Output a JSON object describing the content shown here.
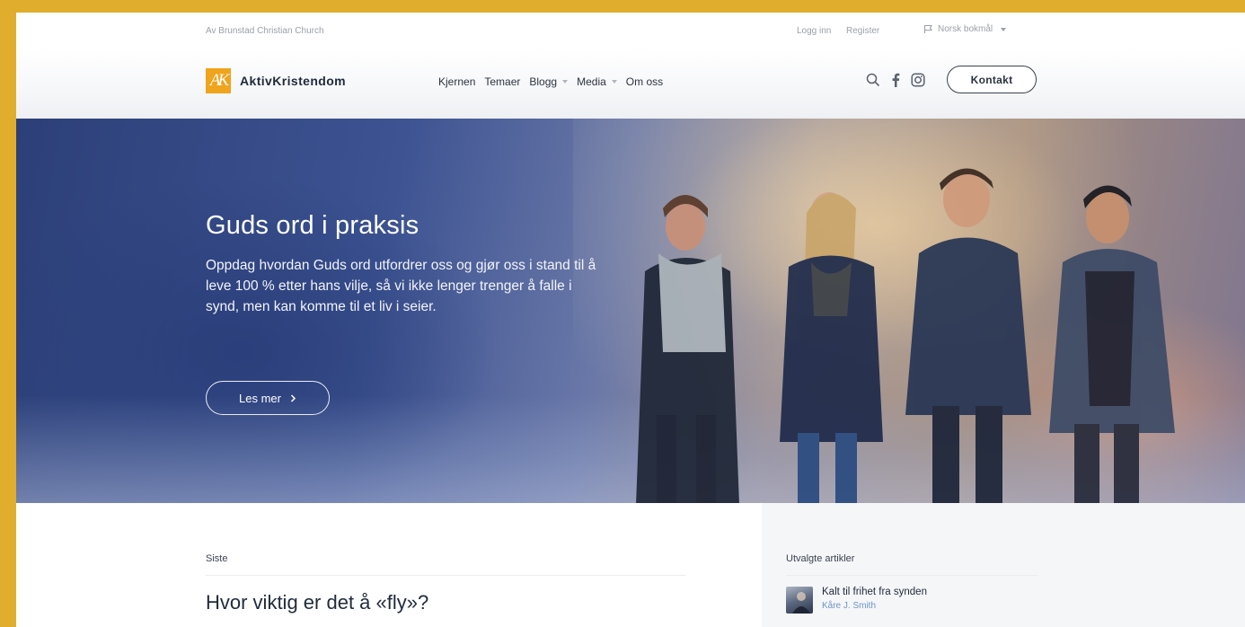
{
  "topbar": {
    "church": "Av Brunstad Christian Church",
    "login": "Logg inn",
    "register": "Register",
    "language": "Norsk bokmål"
  },
  "header": {
    "logo_mark": "AK",
    "logo_text": "AktivKristendom",
    "nav": [
      {
        "label": "Kjernen",
        "dropdown": false
      },
      {
        "label": "Temaer",
        "dropdown": false
      },
      {
        "label": "Blogg",
        "dropdown": true
      },
      {
        "label": "Media",
        "dropdown": true
      },
      {
        "label": "Om oss",
        "dropdown": false
      }
    ],
    "icons": [
      "search-icon",
      "facebook-icon",
      "instagram-icon"
    ],
    "contact_label": "Kontakt"
  },
  "hero": {
    "title": "Guds ord i praksis",
    "description": "Oppdag hvordan Guds ord utfordrer oss og gjør oss i stand til å leve 100 % etter hans vilje, så vi ikke lenger trenger å falle i synd, men kan komme til et liv i seier.",
    "button_label": "Les mer",
    "button_icon": "chevron-right-icon"
  },
  "latest": {
    "label": "Siste",
    "article_title": "Hvor viktig er det å «fly»?"
  },
  "featured": {
    "label": "Utvalgte artikler",
    "items": [
      {
        "title": "Kalt til frihet fra synden",
        "author": "Kåre J. Smith"
      }
    ]
  },
  "colors": {
    "frame": "#e0ae2c",
    "logo_accent": "#f0a31c",
    "text_dark": "#1f2a3c",
    "author_link": "#6b93c8"
  }
}
